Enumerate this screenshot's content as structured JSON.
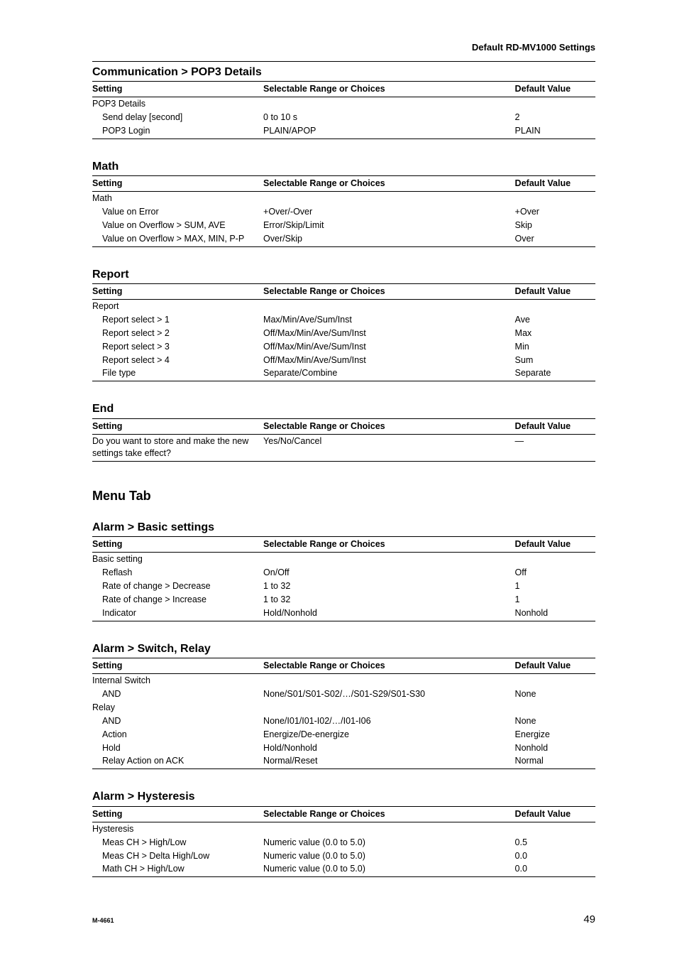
{
  "header": {
    "running": "Default RD-MV1000 Settings"
  },
  "columns": {
    "setting": "Setting",
    "range": "Selectable Range or Choices",
    "default": "Default Value"
  },
  "big_sections": {
    "menu_tab": "Menu Tab"
  },
  "sections": [
    {
      "title": "Communication > POP3 Details",
      "rows": [
        {
          "setting": "POP3 Details",
          "range": "",
          "default": "",
          "indent": 0
        },
        {
          "setting": "Send delay [second]",
          "range": "0 to 10 s",
          "default": "2",
          "indent": 1
        },
        {
          "setting": "POP3 Login",
          "range": "PLAIN/APOP",
          "default": "PLAIN",
          "indent": 1
        }
      ]
    },
    {
      "title": "Math",
      "rows": [
        {
          "setting": "Math",
          "range": "",
          "default": "",
          "indent": 0
        },
        {
          "setting": "Value on Error",
          "range": "+Over/-Over",
          "default": "+Over",
          "indent": 1
        },
        {
          "setting": "Value on Overflow > SUM, AVE",
          "range": "Error/Skip/Limit",
          "default": "Skip",
          "indent": 1
        },
        {
          "setting": "Value on Overflow > MAX, MIN, P-P",
          "range": "Over/Skip",
          "default": "Over",
          "indent": 1
        }
      ]
    },
    {
      "title": "Report",
      "rows": [
        {
          "setting": "Report",
          "range": "",
          "default": "",
          "indent": 0
        },
        {
          "setting": "Report select > 1",
          "range": "Max/Min/Ave/Sum/Inst",
          "default": "Ave",
          "indent": 1
        },
        {
          "setting": "Report select > 2",
          "range": "Off/Max/Min/Ave/Sum/Inst",
          "default": "Max",
          "indent": 1
        },
        {
          "setting": "Report select > 3",
          "range": "Off/Max/Min/Ave/Sum/Inst",
          "default": "Min",
          "indent": 1
        },
        {
          "setting": "Report select > 4",
          "range": "Off/Max/Min/Ave/Sum/Inst",
          "default": "Sum",
          "indent": 1
        },
        {
          "setting": "File type",
          "range": "Separate/Combine",
          "default": "Separate",
          "indent": 1
        }
      ]
    },
    {
      "title": "End",
      "rows": [
        {
          "setting": "Do you want to store and make the new settings take effect?",
          "range": "Yes/No/Cancel",
          "default": "—",
          "indent": 0
        }
      ]
    }
  ],
  "menu_sections": [
    {
      "title": "Alarm > Basic settings",
      "rows": [
        {
          "setting": "Basic setting",
          "range": "",
          "default": "",
          "indent": 0
        },
        {
          "setting": "Reflash",
          "range": "On/Off",
          "default": "Off",
          "indent": 1
        },
        {
          "setting": "Rate of change > Decrease",
          "range": "1 to 32",
          "default": "1",
          "indent": 1
        },
        {
          "setting": "Rate of change > Increase",
          "range": "1 to 32",
          "default": "1",
          "indent": 1
        },
        {
          "setting": "Indicator",
          "range": "Hold/Nonhold",
          "default": "Nonhold",
          "indent": 1
        }
      ]
    },
    {
      "title": "Alarm > Switch, Relay",
      "rows": [
        {
          "setting": "Internal Switch",
          "range": "",
          "default": "",
          "indent": 0
        },
        {
          "setting": "AND",
          "range": "None/S01/S01-S02/…/S01-S29/S01-S30",
          "default": "None",
          "indent": 1
        },
        {
          "setting": "Relay",
          "range": "",
          "default": "",
          "indent": 0
        },
        {
          "setting": "AND",
          "range": "None/I01/I01-I02/…/I01-I06",
          "default": "None",
          "indent": 1
        },
        {
          "setting": "Action",
          "range": "Energize/De-energize",
          "default": "Energize",
          "indent": 1
        },
        {
          "setting": "Hold",
          "range": "Hold/Nonhold",
          "default": "Nonhold",
          "indent": 1
        },
        {
          "setting": "Relay Action on ACK",
          "range": "Normal/Reset",
          "default": "Normal",
          "indent": 1
        }
      ]
    },
    {
      "title": "Alarm > Hysteresis",
      "rows": [
        {
          "setting": "Hysteresis",
          "range": "",
          "default": "",
          "indent": 0
        },
        {
          "setting": "Meas CH > High/Low",
          "range": "Numeric value (0.0 to 5.0)",
          "default": "0.5",
          "indent": 1
        },
        {
          "setting": "Meas CH > Delta High/Low",
          "range": "Numeric value (0.0 to 5.0)",
          "default": "0.0",
          "indent": 1
        },
        {
          "setting": "Math CH > High/Low",
          "range": "Numeric value (0.0 to 5.0)",
          "default": "0.0",
          "indent": 1
        }
      ]
    }
  ],
  "footer": {
    "doc_id": "M-4661",
    "page": "49"
  }
}
